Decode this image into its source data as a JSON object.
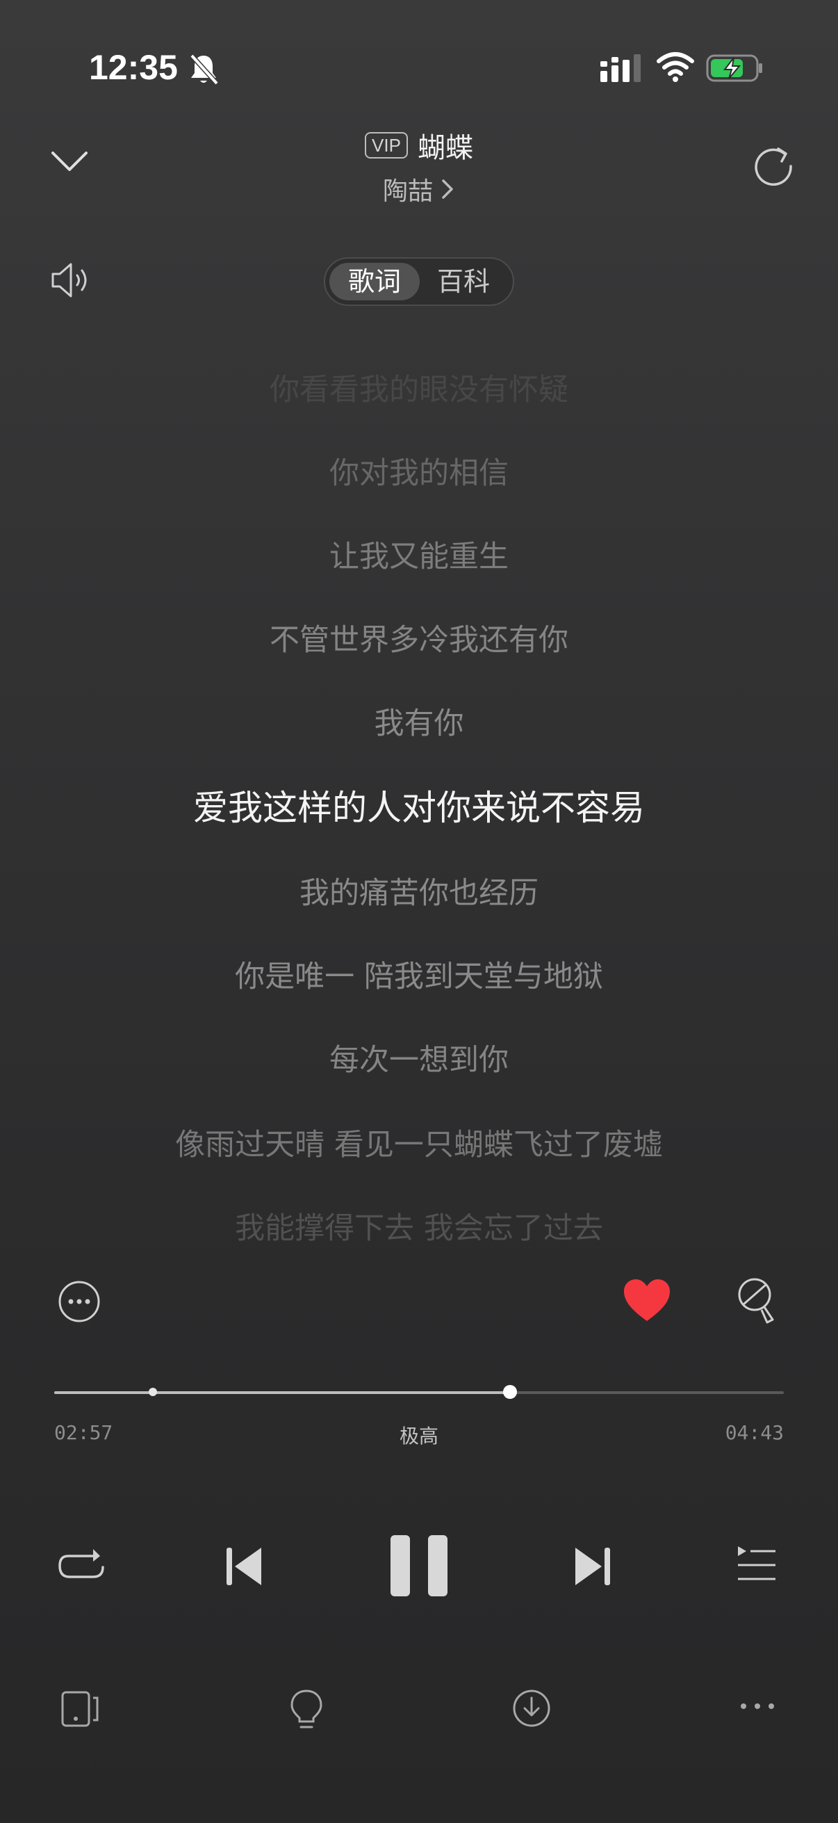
{
  "status_bar": {
    "time": "12:35"
  },
  "header": {
    "vip_badge": "VIP",
    "song_title": "蝴蝶",
    "artist": "陶喆"
  },
  "tabs": [
    {
      "label": "歌词",
      "active": true
    },
    {
      "label": "百科",
      "active": false
    }
  ],
  "lyrics": [
    {
      "text": "你看看我的眼没有怀疑",
      "opacity": 0.22
    },
    {
      "text": "你对我的相信",
      "opacity": 0.6
    },
    {
      "text": "让我又能重生",
      "opacity": 0.85
    },
    {
      "text": "不管世界多冷我还有你",
      "opacity": 0.95
    },
    {
      "text": "我有你",
      "opacity": 1
    },
    {
      "text": "爱我这样的人对你来说不容易",
      "opacity": 1,
      "active": true
    },
    {
      "text": "我的痛苦你也经历",
      "opacity": 1
    },
    {
      "text": "你是唯一 陪我到天堂与地狱",
      "opacity": 1
    },
    {
      "text": "每次一想到你",
      "opacity": 0.95
    },
    {
      "text": "像雨过天晴 看见一只蝴蝶飞过了废墟",
      "opacity": 0.8
    },
    {
      "text": "我能撑得下去 我会忘了过去",
      "opacity": 0.4
    }
  ],
  "player": {
    "current_time": "02:57",
    "quality": "极高",
    "total_time": "04:43",
    "progress_fraction": 0.625,
    "marker_fraction": 0.135,
    "liked": true,
    "like_color": "#f5383f"
  },
  "icons": {
    "close": "chevron-down-icon",
    "share": "refresh-icon",
    "volume": "volume-icon",
    "more_circle": "more-circle-icon",
    "like": "heart-icon",
    "tip": "tip-icon",
    "repeat": "repeat-icon",
    "prev": "previous-icon",
    "pause": "pause-icon",
    "next": "next-icon",
    "playlist": "playlist-icon",
    "device": "device-icon",
    "bulb": "bulb-icon",
    "download": "download-icon",
    "more": "more-dots-icon"
  }
}
